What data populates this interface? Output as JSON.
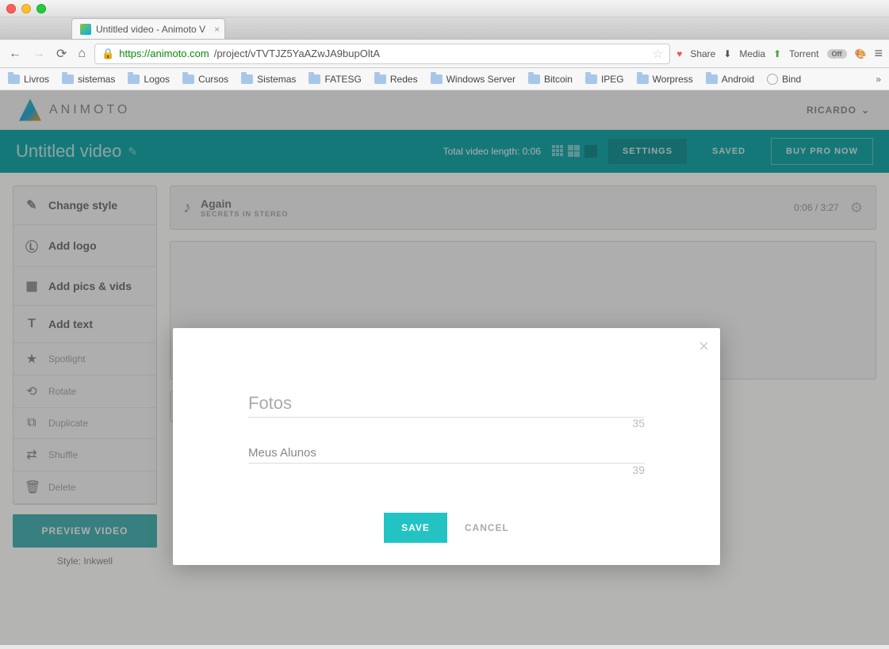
{
  "browser": {
    "tab_title": "Untitled video - Animoto V",
    "url_host": "https://animoto.com",
    "url_path": "/project/vTVTJZ5YaAZwJA9bupOltA",
    "extensions": {
      "share": "Share",
      "media": "Media",
      "torrent": "Torrent",
      "off": "Off"
    },
    "bookmarks": [
      "Livros",
      "sistemas",
      "Logos",
      "Cursos",
      "Sistemas",
      "FATESG",
      "Redes",
      "Windows Server",
      "Bitcoin",
      "IPEG",
      "Worpress",
      "Android",
      "Bind"
    ]
  },
  "app": {
    "brand": "ANIMOTO",
    "user": "RICARDO",
    "title": "Untitled video",
    "video_length_label": "Total video length: 0:06",
    "buttons": {
      "settings": "SETTINGS",
      "saved": "SAVED",
      "buy": "BUY PRO NOW"
    }
  },
  "sidebar": {
    "main": [
      {
        "icon": "brush",
        "label": "Change style"
      },
      {
        "icon": "logo",
        "label": "Add logo"
      },
      {
        "icon": "media",
        "label": "Add pics & vids"
      },
      {
        "icon": "text",
        "label": "Add text"
      }
    ],
    "secondary": [
      {
        "icon": "star",
        "label": "Spotlight"
      },
      {
        "icon": "rotate",
        "label": "Rotate"
      },
      {
        "icon": "dup",
        "label": "Duplicate"
      },
      {
        "icon": "shuffle",
        "label": "Shuffle"
      },
      {
        "icon": "trash",
        "label": "Delete"
      }
    ],
    "preview": "PREVIEW VIDEO",
    "style_label": "Style: Inkwell"
  },
  "music": {
    "title": "Again",
    "artist": "SECRETS IN STEREO",
    "time": "0:06 / 3:27"
  },
  "modal": {
    "title_value": "Fotos",
    "title_counter": "35",
    "subtitle_value": "Meus Alunos",
    "subtitle_counter": "39",
    "save": "SAVE",
    "cancel": "CANCEL"
  }
}
